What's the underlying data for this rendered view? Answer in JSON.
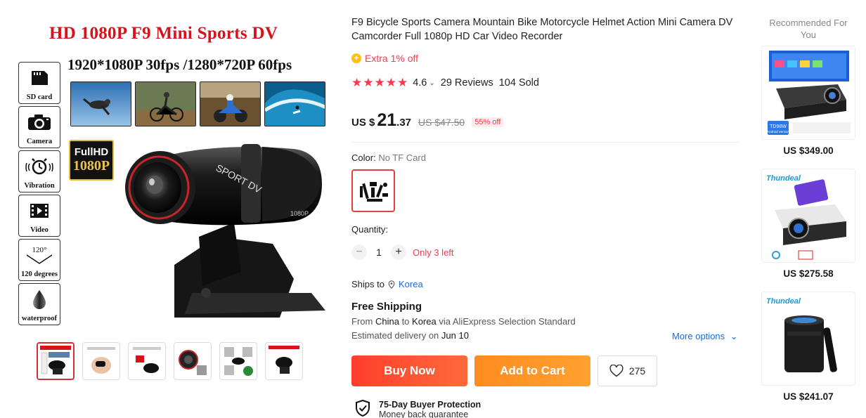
{
  "gallery": {
    "promo_title": "HD 1080P F9 Mini Sports DV",
    "promo_subtitle": "1920*1080P 30fps /1280*720P 60fps",
    "fullhd_badge": {
      "line1": "FullHD",
      "line2": "1080P"
    },
    "camera_text": [
      "SPORT DV",
      "1080P"
    ],
    "features": [
      {
        "icon": "sd-card-icon",
        "label": "SD card"
      },
      {
        "icon": "camera-icon",
        "label": "Camera"
      },
      {
        "icon": "vibration-alarm-icon",
        "label": "Vibration"
      },
      {
        "icon": "video-film-icon",
        "label": "Video"
      },
      {
        "icon": "angle-icon",
        "label": "120 degrees",
        "value": "120°"
      },
      {
        "icon": "waterproof-drop-icon",
        "label": "waterproof"
      }
    ],
    "scenes": [
      "skydiving",
      "mountain-bike",
      "motocross",
      "surfing"
    ],
    "thumbnail_count": 6,
    "active_thumbnail": 0
  },
  "product": {
    "title": "F9 Bicycle Sports Camera Mountain Bike Motorcycle Helmet Action Mini Camera DV Camcorder Full 1080p HD Car Video Recorder",
    "extra_off": "Extra 1% off",
    "rating": "4.6",
    "stars": 5,
    "reviews": "29 Reviews",
    "sold": "104 Sold",
    "price": {
      "currency": "US $",
      "integer": "21",
      "decimal": ".37",
      "original": "US $47.50",
      "discount": "55% off"
    },
    "color": {
      "label": "Color:",
      "value": "No TF Card"
    },
    "quantity": {
      "label": "Quantity:",
      "minus": "−",
      "value": "1",
      "plus": "+",
      "stock": "Only 3 left"
    },
    "ships_to": {
      "label": "Ships to",
      "location": "Korea"
    },
    "shipping": {
      "title": "Free Shipping",
      "from_label": "From",
      "from": "China",
      "to_label": "to",
      "to": "Korea",
      "via": "via AliExpress Selection Standard",
      "delivery_label": "Estimated delivery on",
      "delivery_date": "Jun 10",
      "more_options": "More options"
    },
    "buttons": {
      "buy_now": "Buy Now",
      "add_to_cart": "Add to Cart",
      "wishlist_count": "275"
    },
    "protection": {
      "title": "75-Day Buyer Protection",
      "subtitle": "Money back guarantee"
    }
  },
  "recommended": {
    "title": "Recommended For You",
    "items": [
      {
        "price": "US $349.00",
        "brand": "",
        "badge": "TD98W",
        "badge_sub": "(Android Version)"
      },
      {
        "price": "US $275.58",
        "brand": "Thundeal",
        "badge": "",
        "badge_sub": ""
      },
      {
        "price": "US $241.07",
        "brand": "Thundeal",
        "badge": "",
        "badge_sub": ""
      }
    ]
  },
  "colors": {
    "accent_red": "#fd384f",
    "buy_now": "#ff4a2e",
    "add_to_cart": "#ff9426",
    "link_blue": "#1b6bd8",
    "promo_red": "#d8121b"
  }
}
